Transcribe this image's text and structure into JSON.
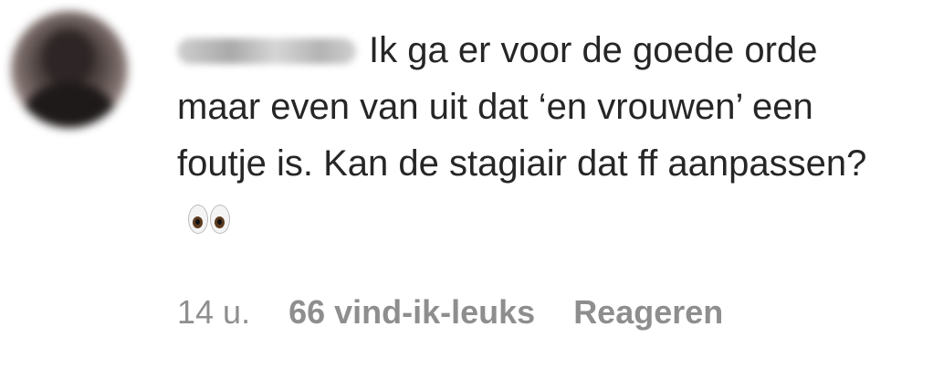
{
  "comment": {
    "username": "nanoahh",
    "text": "Ik ga er voor de goede orde maar even van uit dat ‘en vrouwen’ een foutje is. Kan de stagiair dat ff aanpassen?",
    "emoji": "eyes-emoji",
    "time": "14 u.",
    "likes": "66 vind-ik-leuks",
    "reply_label": "Reageren"
  }
}
